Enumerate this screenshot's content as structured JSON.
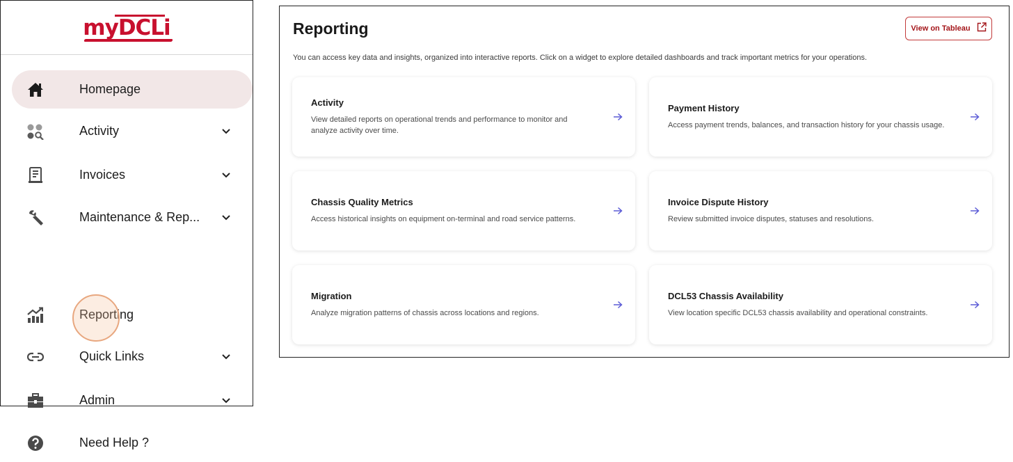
{
  "logo": {
    "my": "my",
    "dcli": "DCLi"
  },
  "sidebar": {
    "items": [
      {
        "label": "Homepage",
        "icon": "home-icon"
      },
      {
        "label": "Activity",
        "icon": "activity-icon"
      },
      {
        "label": "Invoices",
        "icon": "invoice-icon"
      },
      {
        "label": "Maintenance & Rep...",
        "icon": "wrench-icon"
      },
      {
        "label": "Reporting",
        "icon": "chart-icon"
      },
      {
        "label": "Quick Links",
        "icon": "link-icon"
      },
      {
        "label": "Admin",
        "icon": "briefcase-icon"
      },
      {
        "label": "Need Help ?",
        "icon": "help-icon"
      }
    ]
  },
  "main": {
    "title": "Reporting",
    "tableau_button": "View on Tableau",
    "description": "You can access key data and insights, organized into interactive reports. Click on a widget to explore detailed dashboards and track important metrics for your operations.",
    "cards": [
      {
        "title": "Activity",
        "description": "View detailed reports on operational trends and performance to monitor and analyze activity over time."
      },
      {
        "title": "Payment History",
        "description": "Access payment trends, balances, and transaction history for your chassis usage."
      },
      {
        "title": "Chassis Quality Metrics",
        "description": "Access historical insights on equipment on-terminal and road service patterns."
      },
      {
        "title": "Invoice Dispute History",
        "description": "Review submitted invoice disputes, statuses and resolutions."
      },
      {
        "title": "Migration",
        "description": "Analyze migration patterns of chassis across locations and regions."
      },
      {
        "title": "DCL53 Chassis Availability",
        "description": "View location specific DCL53 chassis availability and operational constraints."
      }
    ]
  },
  "colors": {
    "brand": "#c8102e",
    "active_bg": "#f2e7e7",
    "arrow": "#5b5bd6"
  }
}
